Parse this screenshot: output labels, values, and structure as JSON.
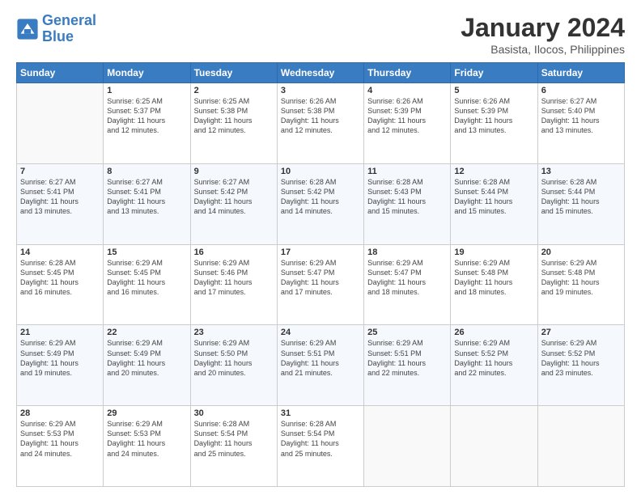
{
  "logo": {
    "line1": "General",
    "line2": "Blue"
  },
  "title": "January 2024",
  "subtitle": "Basista, Ilocos, Philippines",
  "days_header": [
    "Sunday",
    "Monday",
    "Tuesday",
    "Wednesday",
    "Thursday",
    "Friday",
    "Saturday"
  ],
  "weeks": [
    [
      {
        "day": "",
        "info": ""
      },
      {
        "day": "1",
        "info": "Sunrise: 6:25 AM\nSunset: 5:37 PM\nDaylight: 11 hours\nand 12 minutes."
      },
      {
        "day": "2",
        "info": "Sunrise: 6:25 AM\nSunset: 5:38 PM\nDaylight: 11 hours\nand 12 minutes."
      },
      {
        "day": "3",
        "info": "Sunrise: 6:26 AM\nSunset: 5:38 PM\nDaylight: 11 hours\nand 12 minutes."
      },
      {
        "day": "4",
        "info": "Sunrise: 6:26 AM\nSunset: 5:39 PM\nDaylight: 11 hours\nand 12 minutes."
      },
      {
        "day": "5",
        "info": "Sunrise: 6:26 AM\nSunset: 5:39 PM\nDaylight: 11 hours\nand 13 minutes."
      },
      {
        "day": "6",
        "info": "Sunrise: 6:27 AM\nSunset: 5:40 PM\nDaylight: 11 hours\nand 13 minutes."
      }
    ],
    [
      {
        "day": "7",
        "info": "Sunrise: 6:27 AM\nSunset: 5:41 PM\nDaylight: 11 hours\nand 13 minutes."
      },
      {
        "day": "8",
        "info": "Sunrise: 6:27 AM\nSunset: 5:41 PM\nDaylight: 11 hours\nand 13 minutes."
      },
      {
        "day": "9",
        "info": "Sunrise: 6:27 AM\nSunset: 5:42 PM\nDaylight: 11 hours\nand 14 minutes."
      },
      {
        "day": "10",
        "info": "Sunrise: 6:28 AM\nSunset: 5:42 PM\nDaylight: 11 hours\nand 14 minutes."
      },
      {
        "day": "11",
        "info": "Sunrise: 6:28 AM\nSunset: 5:43 PM\nDaylight: 11 hours\nand 15 minutes."
      },
      {
        "day": "12",
        "info": "Sunrise: 6:28 AM\nSunset: 5:44 PM\nDaylight: 11 hours\nand 15 minutes."
      },
      {
        "day": "13",
        "info": "Sunrise: 6:28 AM\nSunset: 5:44 PM\nDaylight: 11 hours\nand 15 minutes."
      }
    ],
    [
      {
        "day": "14",
        "info": "Sunrise: 6:28 AM\nSunset: 5:45 PM\nDaylight: 11 hours\nand 16 minutes."
      },
      {
        "day": "15",
        "info": "Sunrise: 6:29 AM\nSunset: 5:45 PM\nDaylight: 11 hours\nand 16 minutes."
      },
      {
        "day": "16",
        "info": "Sunrise: 6:29 AM\nSunset: 5:46 PM\nDaylight: 11 hours\nand 17 minutes."
      },
      {
        "day": "17",
        "info": "Sunrise: 6:29 AM\nSunset: 5:47 PM\nDaylight: 11 hours\nand 17 minutes."
      },
      {
        "day": "18",
        "info": "Sunrise: 6:29 AM\nSunset: 5:47 PM\nDaylight: 11 hours\nand 18 minutes."
      },
      {
        "day": "19",
        "info": "Sunrise: 6:29 AM\nSunset: 5:48 PM\nDaylight: 11 hours\nand 18 minutes."
      },
      {
        "day": "20",
        "info": "Sunrise: 6:29 AM\nSunset: 5:48 PM\nDaylight: 11 hours\nand 19 minutes."
      }
    ],
    [
      {
        "day": "21",
        "info": "Sunrise: 6:29 AM\nSunset: 5:49 PM\nDaylight: 11 hours\nand 19 minutes."
      },
      {
        "day": "22",
        "info": "Sunrise: 6:29 AM\nSunset: 5:49 PM\nDaylight: 11 hours\nand 20 minutes."
      },
      {
        "day": "23",
        "info": "Sunrise: 6:29 AM\nSunset: 5:50 PM\nDaylight: 11 hours\nand 20 minutes."
      },
      {
        "day": "24",
        "info": "Sunrise: 6:29 AM\nSunset: 5:51 PM\nDaylight: 11 hours\nand 21 minutes."
      },
      {
        "day": "25",
        "info": "Sunrise: 6:29 AM\nSunset: 5:51 PM\nDaylight: 11 hours\nand 22 minutes."
      },
      {
        "day": "26",
        "info": "Sunrise: 6:29 AM\nSunset: 5:52 PM\nDaylight: 11 hours\nand 22 minutes."
      },
      {
        "day": "27",
        "info": "Sunrise: 6:29 AM\nSunset: 5:52 PM\nDaylight: 11 hours\nand 23 minutes."
      }
    ],
    [
      {
        "day": "28",
        "info": "Sunrise: 6:29 AM\nSunset: 5:53 PM\nDaylight: 11 hours\nand 24 minutes."
      },
      {
        "day": "29",
        "info": "Sunrise: 6:29 AM\nSunset: 5:53 PM\nDaylight: 11 hours\nand 24 minutes."
      },
      {
        "day": "30",
        "info": "Sunrise: 6:28 AM\nSunset: 5:54 PM\nDaylight: 11 hours\nand 25 minutes."
      },
      {
        "day": "31",
        "info": "Sunrise: 6:28 AM\nSunset: 5:54 PM\nDaylight: 11 hours\nand 25 minutes."
      },
      {
        "day": "",
        "info": ""
      },
      {
        "day": "",
        "info": ""
      },
      {
        "day": "",
        "info": ""
      }
    ]
  ]
}
